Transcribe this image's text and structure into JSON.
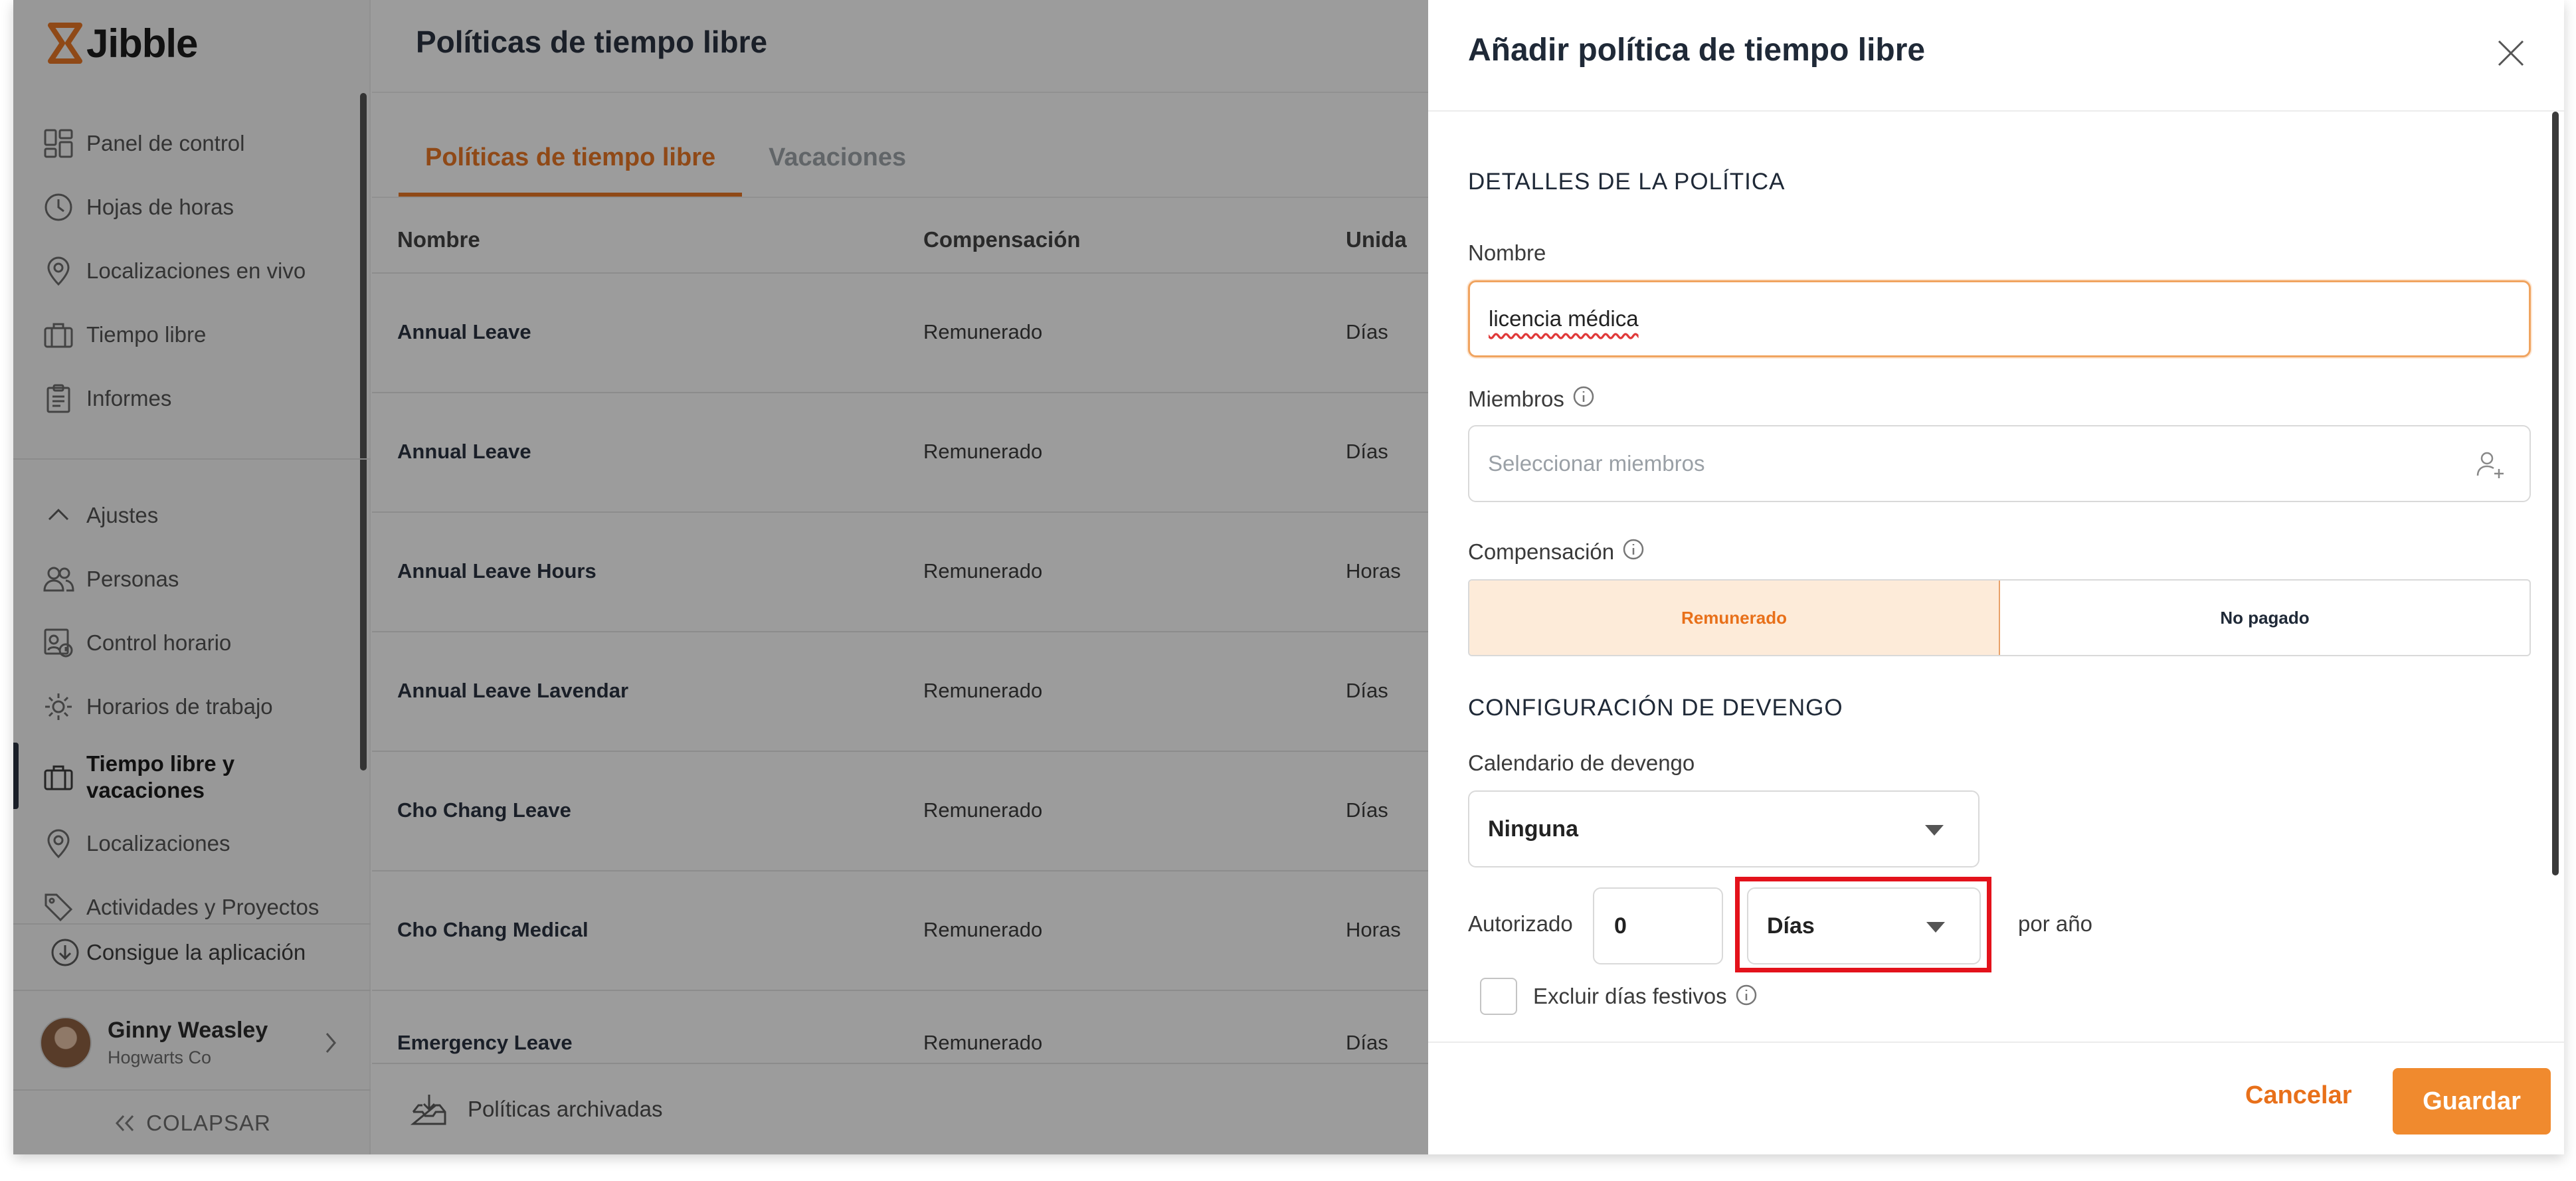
{
  "app": {
    "logo_text": "Jibble"
  },
  "sidebar": {
    "items": [
      {
        "label": "Panel de control",
        "icon": "dashboard-icon"
      },
      {
        "label": "Hojas de horas",
        "icon": "clock-icon"
      },
      {
        "label": "Localizaciones en vivo",
        "icon": "location-pin-icon"
      },
      {
        "label": "Tiempo libre",
        "icon": "suitcase-icon"
      },
      {
        "label": "Informes",
        "icon": "clipboard-icon"
      }
    ],
    "settings_label": "Ajustes",
    "settings_items": [
      {
        "label": "Personas",
        "icon": "people-icon"
      },
      {
        "label": "Control horario",
        "icon": "time-tracking-icon"
      },
      {
        "label": "Horarios de trabajo",
        "icon": "work-schedule-icon"
      },
      {
        "label": "Tiempo libre y vacaciones",
        "icon": "suitcase-icon",
        "active": true
      },
      {
        "label": "Localizaciones",
        "icon": "location-pin-icon"
      },
      {
        "label": "Actividades y Proyectos",
        "icon": "tag-icon"
      }
    ],
    "get_app_label": "Consigue la aplicación",
    "user": {
      "name": "Ginny Weasley",
      "company": "Hogwarts Co"
    },
    "collapse_label": "COLAPSAR"
  },
  "main": {
    "title": "Políticas de tiempo libre",
    "tabs": [
      {
        "label": "Políticas de tiempo libre",
        "active": true
      },
      {
        "label": "Vacaciones",
        "active": false
      }
    ],
    "table": {
      "columns": [
        "Nombre",
        "Compensación",
        "Unida"
      ],
      "rows": [
        {
          "name": "Annual Leave",
          "compensation": "Remunerado",
          "unit": "Días"
        },
        {
          "name": "Annual Leave",
          "compensation": "Remunerado",
          "unit": "Días"
        },
        {
          "name": "Annual Leave Hours",
          "compensation": "Remunerado",
          "unit": "Horas"
        },
        {
          "name": "Annual Leave Lavendar",
          "compensation": "Remunerado",
          "unit": "Días"
        },
        {
          "name": "Cho Chang Leave",
          "compensation": "Remunerado",
          "unit": "Días"
        },
        {
          "name": "Cho Chang Medical",
          "compensation": "Remunerado",
          "unit": "Horas"
        },
        {
          "name": "Emergency Leave",
          "compensation": "Remunerado",
          "unit": "Días"
        }
      ]
    },
    "archived_label": "Políticas archivadas"
  },
  "panel": {
    "title": "Añadir política de tiempo libre",
    "policy_section_title": "DETALLES DE LA POLÍTICA",
    "name_label": "Nombre",
    "name_value": "licencia médica",
    "members_label": "Miembros",
    "members_placeholder": "Seleccionar miembros",
    "compensation_label": "Compensación",
    "compensation_options": [
      "Remunerado",
      "No pagado"
    ],
    "compensation_selected": "Remunerado",
    "accrual_section_title": "CONFIGURACIÓN DE DEVENGO",
    "accrual_schedule_label": "Calendario de devengo",
    "accrual_schedule_value": "Ninguna",
    "authorized_label": "Autorizado",
    "authorized_value": "0",
    "unit_value": "Días",
    "per_year_label": "por año",
    "exclude_holidays_label": "Excluir días festivos",
    "cancel_label": "Cancelar",
    "save_label": "Guardar"
  },
  "colors": {
    "accent": "#e8701a",
    "highlight": "#e3121b",
    "primary_button": "#f08a2e"
  }
}
